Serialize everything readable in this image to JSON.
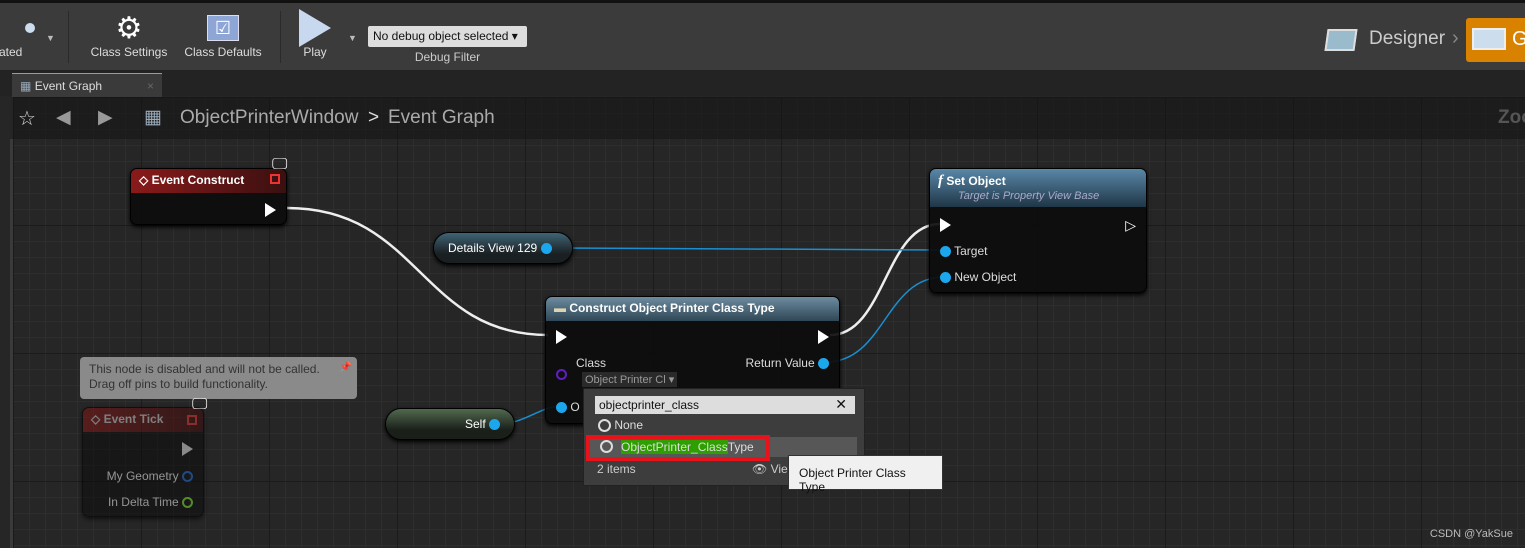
{
  "toolbar": {
    "related_label": "elated",
    "class_settings": "Class Settings",
    "class_defaults": "Class Defaults",
    "play": "Play",
    "debug_select": "No debug object selected",
    "debug_filter": "Debug Filter",
    "designer": "Designer",
    "graph_label": "G"
  },
  "tab": {
    "label": "Event Graph",
    "close": "×"
  },
  "breadcrumb": {
    "blueprint": "ObjectPrinterWindow",
    "separator": ">",
    "graph": "Event Graph",
    "zoom": "Zoo"
  },
  "nodes": {
    "event_construct": {
      "title": "Event Construct"
    },
    "event_tick": {
      "title": "Event Tick",
      "pins": [
        "My Geometry",
        "In Delta Time"
      ],
      "comment": "This node is disabled and will not be called. Drag off pins to build functionality."
    },
    "details_view": {
      "label": "Details View 129"
    },
    "self": {
      "label": "Self"
    },
    "construct": {
      "title": "Construct Object Printer Class Type",
      "class_label": "Class",
      "class_value": "Object Printer Cl",
      "return_label": "Return Value",
      "outer_label": "O"
    },
    "set_object": {
      "title": "Set Object",
      "subtitle": "Target is Property View Base",
      "target": "Target",
      "new_object": "New Object"
    }
  },
  "class_picker": {
    "search_value": "objectprinter_class",
    "items": [
      {
        "label": "None"
      },
      {
        "match": "ObjectPrinter_Class",
        "rest": "Type"
      }
    ],
    "count": "2 items",
    "view_options": "Vie"
  },
  "tooltip": {
    "text": "Object Printer Class Type"
  },
  "watermark": "CSDN @YakSue",
  "colors": {
    "object_pin": "#1aa7ee",
    "event_header": "#8a1a1a",
    "function_header": "#3d6b8a",
    "highlight": "#e8121a",
    "match": "#2e9e00",
    "graph_tab": "#d98200"
  }
}
